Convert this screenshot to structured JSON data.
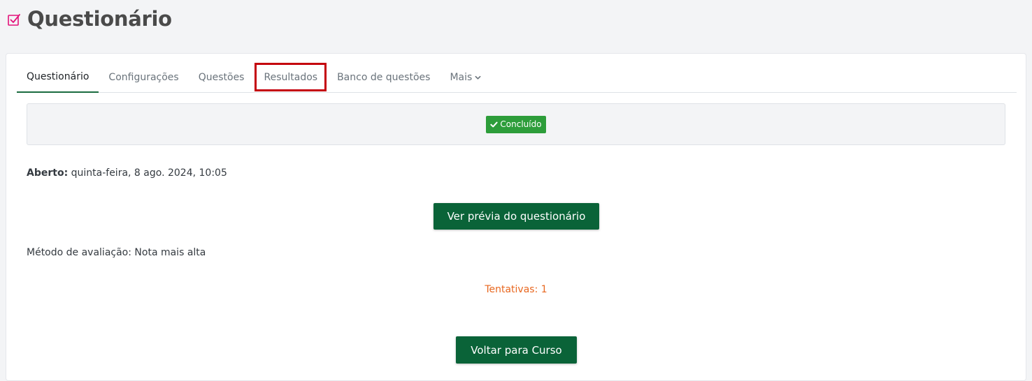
{
  "header": {
    "title": "Questionário",
    "icon": "checkbox-square-icon",
    "icon_color": "#e3127a"
  },
  "tabs": [
    {
      "label": "Questionário",
      "active": true
    },
    {
      "label": "Configurações"
    },
    {
      "label": "Questões"
    },
    {
      "label": "Resultados",
      "highlighted": true
    },
    {
      "label": "Banco de questões"
    },
    {
      "label": "Mais",
      "icon": "chevron-down-icon"
    }
  ],
  "completion": {
    "badge_label": "Concluído",
    "badge_icon": "check-icon",
    "badge_color": "#2d9d3a"
  },
  "details": {
    "open_label": "Aberto:",
    "open_value": "quinta-feira, 8 ago. 2024, 10:05",
    "grade_method": "Método de avaliação: Nota mais alta",
    "attempts": "Tentativas: 1"
  },
  "buttons": {
    "preview": "Ver prévia do questionário",
    "back": "Voltar para Curso"
  },
  "colors": {
    "primary_button": "#0a6338",
    "highlight_outline": "#c4000c",
    "attempts_text": "#e8671f"
  }
}
